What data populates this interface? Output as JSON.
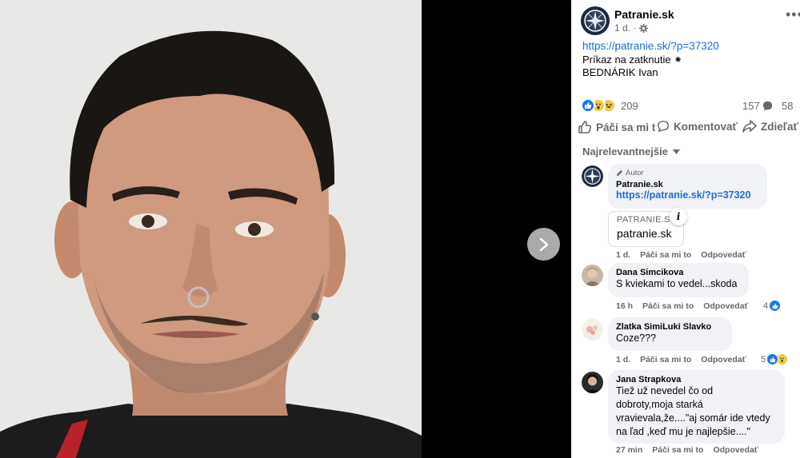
{
  "post": {
    "page_name": "Patranie.sk",
    "time": "1 d.",
    "link": "https://patranie.sk/?p=37320",
    "line1": "Príkaz na zatknutie ⁕",
    "line2": "BEDNÁRIK Ivan"
  },
  "stats": {
    "reactions": "209",
    "comments": "157",
    "shares": "58"
  },
  "actions": {
    "like": "Páči sa mi to",
    "comment": "Komentovať",
    "share": "Zdieľať"
  },
  "sort_label": "Najrelevantnejšie",
  "comments": [
    {
      "badge": "Autor",
      "author": "Patranie.sk",
      "link": "https://patranie.sk/?p=37320",
      "preview_domain": "PATRANIE.SK",
      "preview_title": "patranie.sk",
      "time": "1 d.",
      "like": "Páči sa mi to",
      "reply": "Odpovedať"
    },
    {
      "author": "Dana Simcikova",
      "text": "S kviekami to vedel...skoda",
      "time": "16 h",
      "like": "Páči sa mi to",
      "reply": "Odpovedať",
      "likes": "4"
    },
    {
      "author": "Zlatka SimiLuki Slavko",
      "text": "Coze???",
      "time": "1 d.",
      "like": "Páči sa mi to",
      "reply": "Odpovedať",
      "likes": "5"
    },
    {
      "author": "Jana Strapkova",
      "text_lines": [
        "Tiež už nevedel čo od",
        "dobroty,moja starká",
        "vravievala,že....\"aj somár ide vtedy",
        "na ľad ,keď mu je najlepšie....\""
      ],
      "time": "27 min",
      "like": "Páči sa mi to",
      "reply": "Odpovedať"
    }
  ],
  "colors": {
    "link": "#1a6ed8",
    "like_blue": "#1877f2",
    "muted": "#65676b",
    "bubble": "#f0f2f5"
  },
  "icons": [
    "gear-icon",
    "more-icon",
    "like-icon",
    "comment-icon",
    "share-icon",
    "chevron-down-icon",
    "chevron-right-icon",
    "pencil-icon",
    "info-icon"
  ]
}
